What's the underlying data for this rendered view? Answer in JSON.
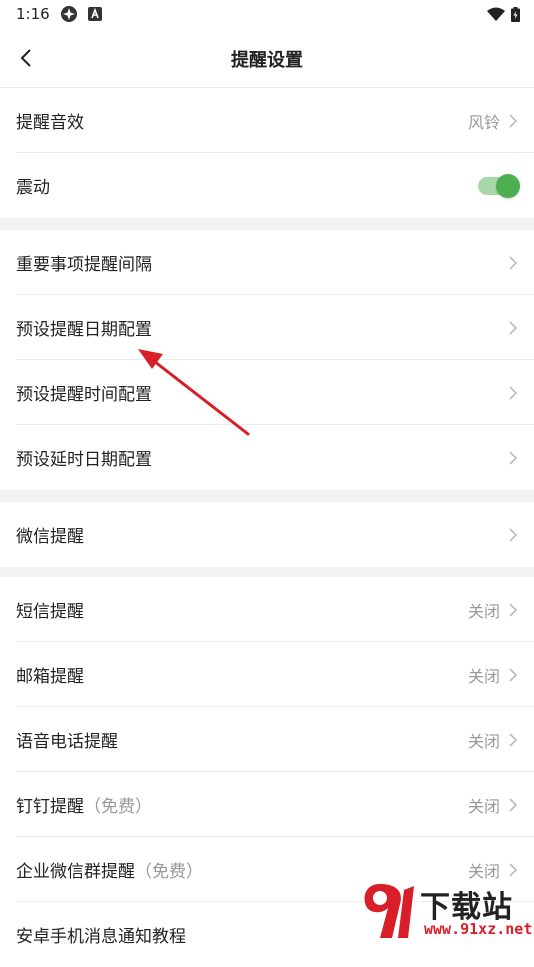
{
  "status_bar": {
    "time": "1:16"
  },
  "header": {
    "title": "提醒设置"
  },
  "groups": [
    {
      "items": [
        {
          "label": "提醒音效",
          "value": "风铃"
        },
        {
          "label": "震动",
          "toggle_on": true
        }
      ]
    },
    {
      "items": [
        {
          "label": "重要事项提醒间隔"
        },
        {
          "label": "预设提醒日期配置"
        },
        {
          "label": "预设提醒时间配置"
        },
        {
          "label": "预设延时日期配置"
        }
      ]
    },
    {
      "items": [
        {
          "label": "微信提醒"
        }
      ]
    },
    {
      "items": [
        {
          "label": "短信提醒",
          "value": "关闭"
        },
        {
          "label": "邮箱提醒",
          "value": "关闭"
        },
        {
          "label": "语音电话提醒",
          "value": "关闭"
        },
        {
          "label": "钉钉提醒",
          "note": "（免费）",
          "value": "关闭"
        },
        {
          "label": "企业微信群提醒",
          "note": "（免费）",
          "value": "关闭"
        },
        {
          "label": "安卓手机消息通知教程"
        }
      ]
    }
  ],
  "watermark": {
    "brand": "下载站",
    "url": "www.91xz.net"
  },
  "colors": {
    "toggle_on": "#4caf50",
    "annotation_arrow": "#d81e29"
  }
}
